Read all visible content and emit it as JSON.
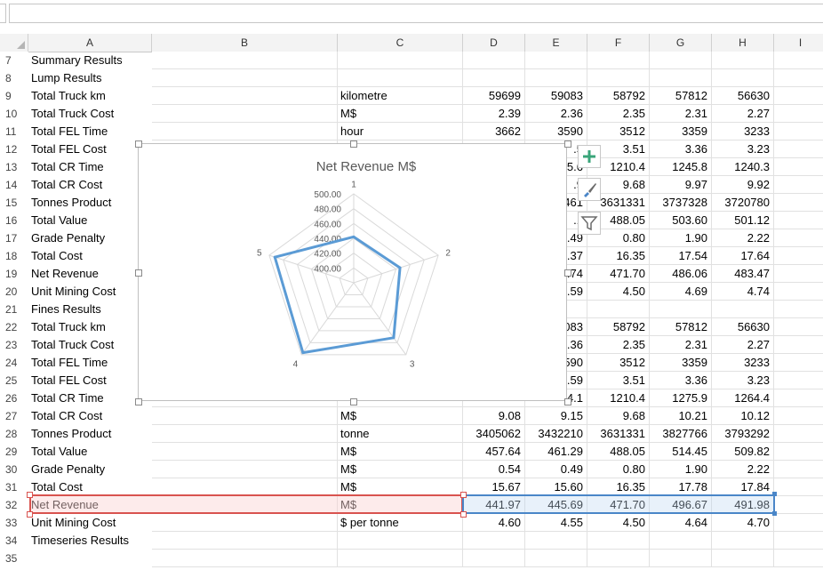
{
  "columns": [
    "A",
    "B",
    "C",
    "D",
    "E",
    "F",
    "G",
    "H",
    "I"
  ],
  "rows": [
    {
      "n": "7",
      "a": "Summary Results",
      "indent": 1,
      "c": "",
      "d": "",
      "e": "",
      "f": "",
      "g": "",
      "h": ""
    },
    {
      "n": "8",
      "a": "Lump Results",
      "indent": 2,
      "c": "",
      "d": "",
      "e": "",
      "f": "",
      "g": "",
      "h": ""
    },
    {
      "n": "9",
      "a": "Total Truck km",
      "indent": 3,
      "c": "kilometre",
      "d": "59699",
      "e": "59083",
      "f": "58792",
      "g": "57812",
      "h": "56630"
    },
    {
      "n": "10",
      "a": "Total Truck Cost",
      "indent": 3,
      "c": "M$",
      "d": "2.39",
      "e": "2.36",
      "f": "2.35",
      "g": "2.31",
      "h": "2.27"
    },
    {
      "n": "11",
      "a": "Total FEL Time",
      "indent": 3,
      "c": "hour",
      "d": "3662",
      "e": "3590",
      "f": "3512",
      "g": "3359",
      "h": "3233"
    },
    {
      "n": "12",
      "a": "Total FEL Cost",
      "indent": 3,
      "c": "",
      "d": "",
      "e": ".5",
      "f": "3.51",
      "g": "3.36",
      "h": "3.23"
    },
    {
      "n": "13",
      "a": "Total CR Time",
      "indent": 3,
      "c": "",
      "d": "",
      "e": "5.6",
      "f": "1210.4",
      "g": "1245.8",
      "h": "1240.3"
    },
    {
      "n": "14",
      "a": "Total CR Cost",
      "indent": 3,
      "c": "",
      "d": "",
      "e": ".9",
      "f": "9.68",
      "g": "9.97",
      "h": "9.92"
    },
    {
      "n": "15",
      "a": "Tonnes Product",
      "indent": 3,
      "c": "",
      "d": "",
      "e": "461",
      "f": "3631331",
      "g": "3737328",
      "h": "3720780"
    },
    {
      "n": "16",
      "a": "Total Value",
      "indent": 3,
      "c": "",
      "d": "",
      "e": ".1",
      "f": "488.05",
      "g": "503.60",
      "h": "501.12"
    },
    {
      "n": "17",
      "a": "Grade Penalty",
      "indent": 3,
      "c": "",
      "d": "",
      "e": ".49",
      "f": "0.80",
      "g": "1.90",
      "h": "2.22"
    },
    {
      "n": "18",
      "a": "Total Cost",
      "indent": 3,
      "c": "",
      "d": "",
      "e": ".37",
      "f": "16.35",
      "g": "17.54",
      "h": "17.64"
    },
    {
      "n": "19",
      "a": "Net Revenue",
      "indent": 3,
      "c": "",
      "d": "",
      "e": ".74",
      "f": "471.70",
      "g": "486.06",
      "h": "483.47"
    },
    {
      "n": "20",
      "a": "Unit Mining Cost",
      "indent": 3,
      "c": "",
      "d": "",
      "e": ".59",
      "f": "4.50",
      "g": "4.69",
      "h": "4.74"
    },
    {
      "n": "21",
      "a": "Fines Results",
      "indent": 2,
      "c": "",
      "d": "",
      "e": "",
      "f": "",
      "g": "",
      "h": ""
    },
    {
      "n": "22",
      "a": "Total Truck km",
      "indent": 3,
      "c": "",
      "d": "",
      "e": "083",
      "f": "58792",
      "g": "57812",
      "h": "56630"
    },
    {
      "n": "23",
      "a": "Total Truck Cost",
      "indent": 3,
      "c": "",
      "d": "",
      "e": ".36",
      "f": "2.35",
      "g": "2.31",
      "h": "2.27"
    },
    {
      "n": "24",
      "a": "Total FEL Time",
      "indent": 3,
      "c": "",
      "d": "",
      "e": "590",
      "f": "3512",
      "g": "3359",
      "h": "3233"
    },
    {
      "n": "25",
      "a": "Total FEL Cost",
      "indent": 3,
      "c": "",
      "d": "",
      "e": ".59",
      "f": "3.51",
      "g": "3.36",
      "h": "3.23"
    },
    {
      "n": "26",
      "a": "Total CR Time",
      "indent": 3,
      "c": "",
      "d": "",
      "e": "4.1",
      "f": "1210.4",
      "g": "1275.9",
      "h": "1264.4"
    },
    {
      "n": "27",
      "a": "Total CR Cost",
      "indent": 3,
      "c": "M$",
      "d": "9.08",
      "e": "9.15",
      "f": "9.68",
      "g": "10.21",
      "h": "10.12"
    },
    {
      "n": "28",
      "a": "Tonnes Product",
      "indent": 3,
      "c": "tonne",
      "d": "3405062",
      "e": "3432210",
      "f": "3631331",
      "g": "3827766",
      "h": "3793292"
    },
    {
      "n": "29",
      "a": "Total Value",
      "indent": 3,
      "c": "M$",
      "d": "457.64",
      "e": "461.29",
      "f": "488.05",
      "g": "514.45",
      "h": "509.82"
    },
    {
      "n": "30",
      "a": "Grade Penalty",
      "indent": 3,
      "c": "M$",
      "d": "0.54",
      "e": "0.49",
      "f": "0.80",
      "g": "1.90",
      "h": "2.22"
    },
    {
      "n": "31",
      "a": "Total Cost",
      "indent": 3,
      "c": "M$",
      "d": "15.67",
      "e": "15.60",
      "f": "16.35",
      "g": "17.78",
      "h": "17.84"
    },
    {
      "n": "32",
      "a": "Net Revenue",
      "indent": 3,
      "c": "M$",
      "d": "441.97",
      "e": "445.69",
      "f": "471.70",
      "g": "496.67",
      "h": "491.98"
    },
    {
      "n": "33",
      "a": "Unit Mining Cost",
      "indent": 3,
      "c": "$ per tonne",
      "d": "4.60",
      "e": "4.55",
      "f": "4.50",
      "g": "4.64",
      "h": "4.70"
    },
    {
      "n": "34",
      "a": "Timeseries Results",
      "indent": 1,
      "c": "",
      "d": "",
      "e": "",
      "f": "",
      "g": "",
      "h": ""
    },
    {
      "n": "35",
      "a": "",
      "indent": 1,
      "c": "",
      "d": "",
      "e": "",
      "f": "",
      "g": "",
      "h": ""
    }
  ],
  "chart_buttons": [
    "plus-icon",
    "brush-icon",
    "filter-icon"
  ],
  "colors": {
    "series": "#5b9bd5",
    "grid": "#d9d9d9",
    "selection_red": "#d9534f",
    "selection_blue": "#4a86c8"
  },
  "chart_data": {
    "type": "radar",
    "title": "Net Revenue M$",
    "categories": [
      "1",
      "2",
      "3",
      "4",
      "5"
    ],
    "values": [
      441.97,
      445.69,
      471.7,
      496.67,
      491.98
    ],
    "rlim": [
      380,
      500
    ],
    "ticks": [
      "500.00",
      "480.00",
      "460.00",
      "440.00",
      "420.00",
      "400.00"
    ],
    "grid": true,
    "legend": "none"
  }
}
